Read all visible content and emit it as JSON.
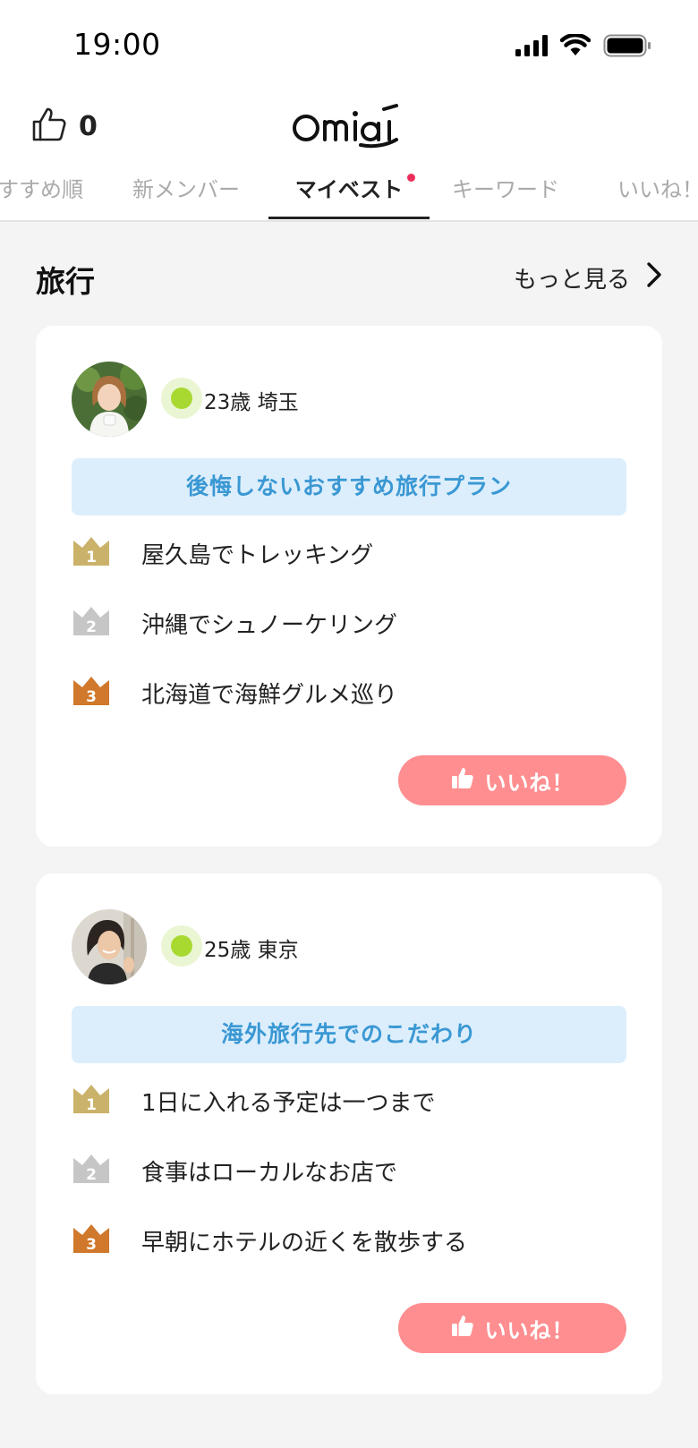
{
  "status_bar": {
    "time": "19:00"
  },
  "header": {
    "likes_count": "0",
    "logo_text": "Omiai"
  },
  "tabs": [
    {
      "label": "すすめ順",
      "active": false
    },
    {
      "label": "新メンバー",
      "active": false
    },
    {
      "label": "マイベスト",
      "active": true
    },
    {
      "label": "キーワード",
      "active": false
    },
    {
      "label": "いいね！",
      "active": false
    }
  ],
  "section": {
    "title": "旅行",
    "more_label": "もっと見る"
  },
  "cards": [
    {
      "profile": "23歳 埼玉",
      "theme": "後悔しないおすすめ旅行プラン",
      "ranks": [
        {
          "num": "1",
          "text": "屋久島でトレッキング"
        },
        {
          "num": "2",
          "text": "沖縄でシュノーケリング"
        },
        {
          "num": "3",
          "text": "北海道で海鮮グルメ巡り"
        }
      ],
      "like_label": "いいね！"
    },
    {
      "profile": "25歳 東京",
      "theme": "海外旅行先でのこだわり",
      "ranks": [
        {
          "num": "1",
          "text": "1日に入れる予定は一つまで"
        },
        {
          "num": "2",
          "text": "食事はローカルなお店で"
        },
        {
          "num": "3",
          "text": "早朝にホテルの近くを散歩する"
        }
      ],
      "like_label": "いいね！"
    }
  ],
  "colors": {
    "gold": "#cbb26a",
    "silver": "#c6c6c6",
    "bronze": "#d0782b",
    "theme_bg": "#dceefc",
    "theme_text": "#3a98d3",
    "like_button": "#ff8e90",
    "online": "#a8d931",
    "tab_dot": "#ee2e5a"
  }
}
